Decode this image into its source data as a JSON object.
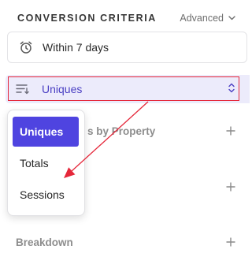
{
  "header": {
    "title": "CONVERSION CRITERIA",
    "advanced_label": "Advanced",
    "advanced_icon": "chevron-down-icon"
  },
  "conversion_window": {
    "label": "Within 7 days",
    "icon": "alarm-clock-icon"
  },
  "count_selector": {
    "value": "Uniques",
    "left_icon": "sort-lines-icon",
    "right_icon": "up-down-chevron-icon",
    "accent": "#4a3fc3",
    "highlight_border": "#e5273a"
  },
  "rows": {
    "holding_constant": {
      "label": "s by Property",
      "icon": "plus-icon"
    },
    "exclusion": {
      "label": "",
      "icon": "plus-icon"
    },
    "breakdown": {
      "label": "Breakdown",
      "icon": "plus-icon"
    }
  },
  "dropdown": {
    "options": [
      "Uniques",
      "Totals",
      "Sessions"
    ],
    "selected": "Uniques",
    "selected_color": "#4f44e0"
  },
  "annotation": {
    "arrow_color": "#e5273a"
  }
}
